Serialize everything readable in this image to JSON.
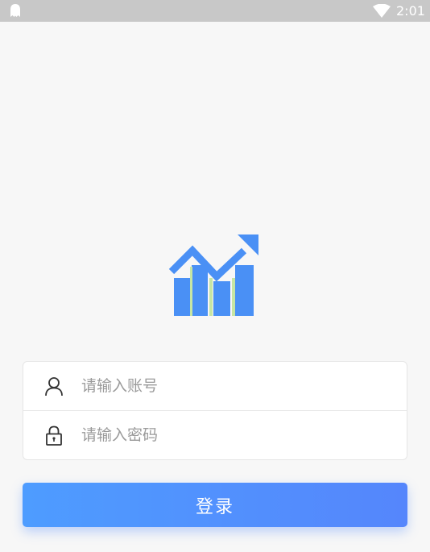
{
  "status_bar": {
    "left_icon": "notification-ghost-icon",
    "wifi_icon": "wifi-icon",
    "time": "2:01"
  },
  "logo": {
    "icon": "growth-chart-logo",
    "colors": {
      "bars": "#4a90f5",
      "stripes": "#c7e6a3"
    }
  },
  "form": {
    "account": {
      "icon": "user-icon",
      "value": "",
      "placeholder": "请输入账号"
    },
    "password": {
      "icon": "lock-icon",
      "value": "",
      "placeholder": "请输入密码"
    }
  },
  "login_button": {
    "label": "登录",
    "colors": {
      "start": "#4e9cff",
      "end": "#5586fc"
    }
  }
}
